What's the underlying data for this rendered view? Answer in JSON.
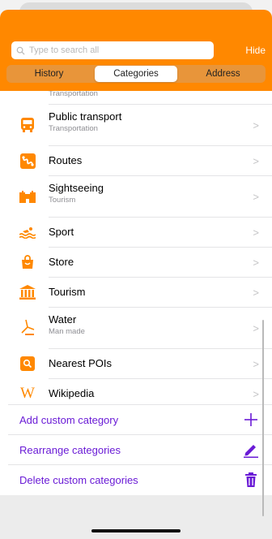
{
  "search": {
    "placeholder": "Type to search all",
    "hide_label": "Hide"
  },
  "tabs": [
    {
      "label": "History",
      "active": false
    },
    {
      "label": "Categories",
      "active": true
    },
    {
      "label": "Address",
      "active": false
    }
  ],
  "partial_row_subtitle": "Transportation",
  "categories": [
    {
      "title": "Public transport",
      "subtitle": "Transportation",
      "icon": "bus-icon"
    },
    {
      "title": "Routes",
      "subtitle": "",
      "icon": "routes-icon"
    },
    {
      "title": "Sightseeing",
      "subtitle": "Tourism",
      "icon": "castle-icon"
    },
    {
      "title": "Sport",
      "subtitle": "",
      "icon": "swimmer-icon"
    },
    {
      "title": "Store",
      "subtitle": "",
      "icon": "shopping-bag-icon"
    },
    {
      "title": "Tourism",
      "subtitle": "",
      "icon": "museum-icon"
    },
    {
      "title": "Water",
      "subtitle": "Man made",
      "icon": "water-tap-icon"
    },
    {
      "title": "Nearest POIs",
      "subtitle": "",
      "icon": "search-poi-icon"
    },
    {
      "title": "Wikipedia",
      "subtitle": "",
      "icon": "wikipedia-icon"
    }
  ],
  "actions": [
    {
      "label": "Add custom category",
      "icon": "plus-icon"
    },
    {
      "label": "Rearrange categories",
      "icon": "pencil-icon"
    },
    {
      "label": "Delete custom categories",
      "icon": "trash-icon"
    }
  ],
  "colors": {
    "accent": "#ff8800",
    "action": "#6a1bd6",
    "icon": "#ff8800"
  }
}
